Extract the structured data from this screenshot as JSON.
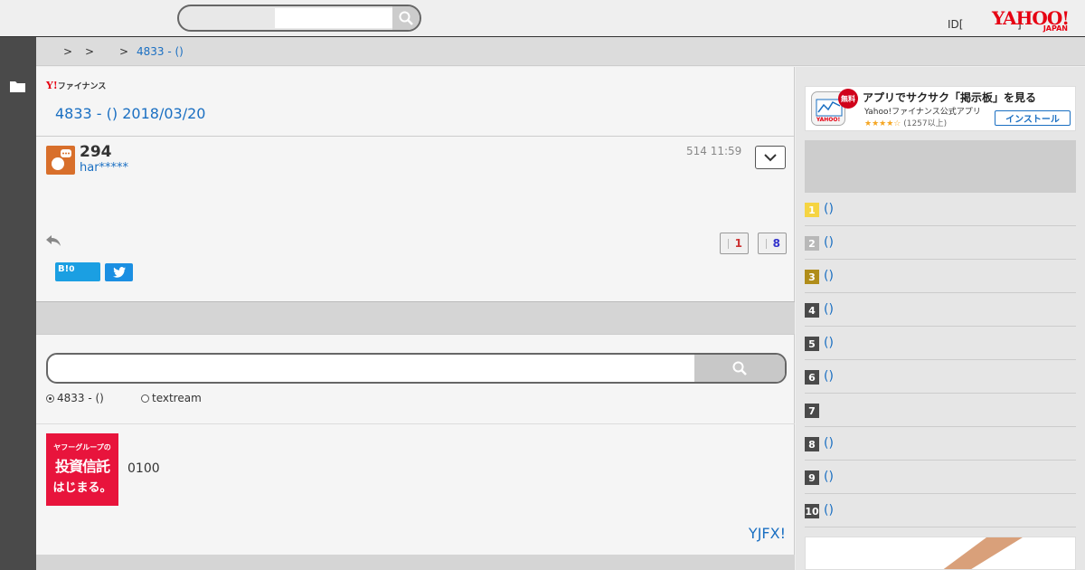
{
  "header": {
    "search_placeholder": "",
    "id_text": "ID[",
    "id_close": "]",
    "logo_main": "YAHOO!",
    "logo_sub": "JAPAN"
  },
  "breadcrumb": {
    "sep1": ">",
    "sep2": ">",
    "sep3": ">",
    "current": "4833 - ()"
  },
  "main": {
    "fin_logo_y": "Y!",
    "fin_logo_text": "ファイナンス",
    "board_title": "4833 - () 2018/03/20",
    "post": {
      "number": "294",
      "user": "har*****",
      "date": "514 11:59",
      "vote_up": "1",
      "vote_down": "8",
      "hatena_label": "B!",
      "hatena_count": "0"
    },
    "search": {
      "radio_board": "4833 - ()",
      "radio_textream": "textream"
    },
    "ad": {
      "banner_line1": "ヤフーグループの",
      "banner_line2": "投資信託",
      "banner_line3": "はじまる。",
      "text": "0100"
    },
    "fx_link": "YJFX!"
  },
  "sidebar": {
    "app_ad": {
      "badge": "無料",
      "title": "アプリでサクサク「掲示板」を見る",
      "subtitle": "Yahoo!ファイナンス公式アプリ",
      "stars": "★★★★☆",
      "count": "(1257以上)",
      "install": "インストール",
      "icon_text": "YAHOO!"
    },
    "ranking": [
      {
        "rank": "1",
        "label": "()"
      },
      {
        "rank": "2",
        "label": "()"
      },
      {
        "rank": "3",
        "label": "()"
      },
      {
        "rank": "4",
        "label": "()"
      },
      {
        "rank": "5",
        "label": "()"
      },
      {
        "rank": "6",
        "label": "()"
      },
      {
        "rank": "7",
        "label": ""
      },
      {
        "rank": "8",
        "label": "()"
      },
      {
        "rank": "9",
        "label": "()"
      },
      {
        "rank": "10",
        "label": "()"
      }
    ]
  },
  "colors": {
    "link": "#1a6fc2",
    "brand_red": "#e60012",
    "rail": "#4a4a4a"
  }
}
